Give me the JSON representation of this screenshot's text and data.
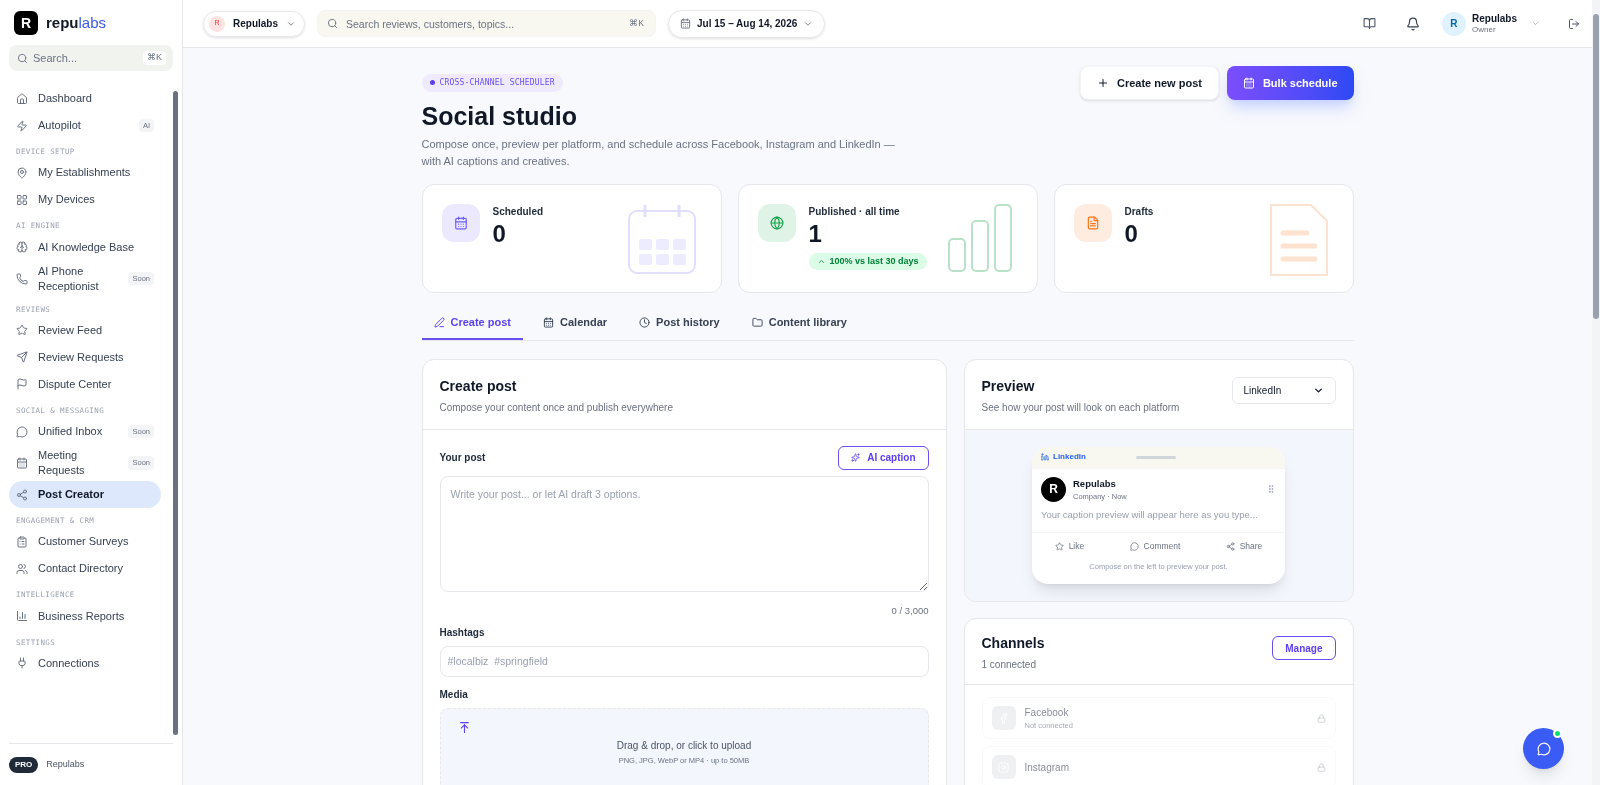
{
  "sidebar": {
    "brand_mark": "R",
    "brand_parts": [
      "repu",
      "labs"
    ],
    "search": {
      "placeholder": "Search...",
      "shortcut": "⌘K"
    },
    "groups": [
      {
        "items": [
          {
            "label": "Dashboard",
            "selected": false
          },
          {
            "label": "Autopilot",
            "badge": "AI",
            "selected": false
          }
        ]
      },
      {
        "heading": "DEVICE SETUP",
        "items": [
          {
            "label": "My Establishments",
            "selected": false
          },
          {
            "label": "My Devices",
            "selected": false
          }
        ]
      },
      {
        "heading": "AI ENGINE",
        "items": [
          {
            "label": "AI Knowledge Base",
            "selected": false
          },
          {
            "label": "AI Phone Receptionist",
            "badge": "Soon",
            "selected": false
          }
        ]
      },
      {
        "heading": "REVIEWS",
        "items": [
          {
            "label": "Review Feed",
            "selected": false
          },
          {
            "label": "Review Requests",
            "selected": false
          },
          {
            "label": "Dispute Center",
            "selected": false
          }
        ]
      },
      {
        "heading": "SOCIAL & MESSAGING",
        "items": [
          {
            "label": "Unified Inbox",
            "badge": "Soon",
            "selected": false
          },
          {
            "label": "Meeting Requests",
            "badge": "Soon",
            "selected": false
          },
          {
            "label": "Post Creator",
            "selected": true
          }
        ]
      },
      {
        "heading": "ENGAGEMENT & CRM",
        "items": [
          {
            "label": "Customer Surveys",
            "selected": false
          },
          {
            "label": "Contact Directory",
            "selected": false
          }
        ]
      },
      {
        "heading": "INTELLIGENCE",
        "items": [
          {
            "label": "Business Reports",
            "selected": false
          }
        ]
      },
      {
        "heading": "SETTINGS",
        "items": [
          {
            "label": "Connections",
            "selected": false
          }
        ]
      }
    ],
    "footer": {
      "plan": "PRO",
      "name": "Repulabs"
    }
  },
  "topbar": {
    "workspace": {
      "avatar": "R",
      "name": "Repulabs"
    },
    "search": {
      "placeholder": "Search reviews, customers, topics...",
      "shortcut": "⌘K"
    },
    "date_range": "Jul 15 – Aug 14, 2026",
    "user": {
      "avatar": "R",
      "name": "Repulabs",
      "role": "Owner"
    }
  },
  "header": {
    "eyebrow": "CROSS-CHANNEL SCHEDULER",
    "title": "Social studio",
    "description": "Compose once, preview per platform, and schedule across Facebook, Instagram and LinkedIn — with AI captions and creatives.",
    "buttons": [
      {
        "label": "Create new post",
        "kind": "secondary"
      },
      {
        "label": "Bulk schedule",
        "kind": "primary"
      }
    ]
  },
  "stats": [
    {
      "label": "Scheduled",
      "value": "0",
      "kind": "calendar",
      "color": "#6d5dfc"
    },
    {
      "label": "Published · all time",
      "value": "1",
      "trend": "100% vs last 30 days",
      "kind": "bars",
      "color": "#16a34a"
    },
    {
      "label": "Drafts",
      "value": "0",
      "kind": "document",
      "color": "#f97316"
    }
  ],
  "tabs": [
    {
      "label": "Create post",
      "selected": true
    },
    {
      "label": "Calendar",
      "selected": false
    },
    {
      "label": "Post history",
      "selected": false
    },
    {
      "label": "Content library",
      "selected": false
    }
  ],
  "create_post": {
    "title": "Create post",
    "subtitle": "Compose your content once and publish everywhere",
    "post_label": "Your post",
    "ai_button": "AI caption",
    "post_placeholder": "Write your post... or let AI draft 3 options.",
    "counter": "0 / 3,000",
    "hashtags_label": "Hashtags",
    "hashtags_placeholder": "#localbiz  #springfield",
    "media_label": "Media",
    "upload_text": "Drag & drop, or click to upload",
    "upload_hint": "PNG, JPG, WebP or MP4 · up to 50MB"
  },
  "preview": {
    "title": "Preview",
    "subtitle": "See how your post will look on each platform",
    "platform": "LinkedIn",
    "mock": {
      "platform": "LinkedIn",
      "account": "Repulabs",
      "avatar": "R",
      "meta": "Company · Now",
      "caption": "Your caption preview will appear here as you type...",
      "actions": [
        "Like",
        "Comment",
        "Share"
      ],
      "footer": "Compose on the left to preview your post."
    }
  },
  "channels": {
    "title": "Channels",
    "subtitle": "1 connected",
    "button": "Manage",
    "items": [
      {
        "name": "Facebook",
        "status": "Not connected",
        "connected": false
      },
      {
        "name": "Instagram",
        "connected": false
      }
    ]
  }
}
